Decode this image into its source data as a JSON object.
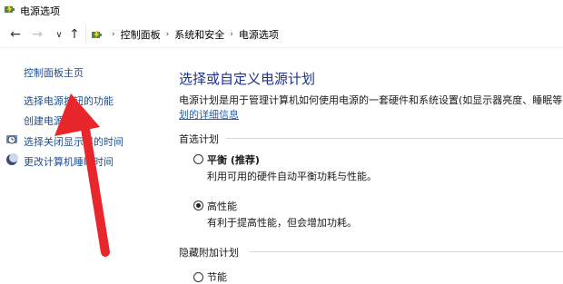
{
  "window": {
    "title": "电源选项"
  },
  "nav": {
    "back": "←",
    "forward": "→",
    "recent": "∨",
    "up": "↑"
  },
  "breadcrumb": [
    "控制面板",
    "系统和安全",
    "电源选项"
  ],
  "sidebar": {
    "items": [
      {
        "label": "控制面板主页"
      },
      {
        "label": "选择电源按钮的功能"
      },
      {
        "label": "创建电源计划"
      },
      {
        "label": "选择关闭显示器的时间",
        "icon": "clock-icon"
      },
      {
        "label": "更改计算机睡眠时间",
        "icon": "moon-icon"
      }
    ]
  },
  "main": {
    "title": "选择或自定义电源计划",
    "description": "电源计划是用于管理计算机如何使用电源的一套硬件和系统设置(如显示器亮度、睡眠等)",
    "details_link": "划的详细信息",
    "preferred_section": "首选计划",
    "plans": [
      {
        "name": "平衡 (推荐)",
        "desc": "利用可用的硬件自动平衡功耗与性能。",
        "selected": false
      },
      {
        "name": "高性能",
        "desc": "有利于提高性能，但会增加功耗。",
        "selected": true
      }
    ],
    "hidden_section": "隐藏附加计划",
    "hidden_plans": [
      {
        "name": "节能",
        "selected": false
      }
    ]
  },
  "annotation": {
    "color": "#e8262b"
  }
}
